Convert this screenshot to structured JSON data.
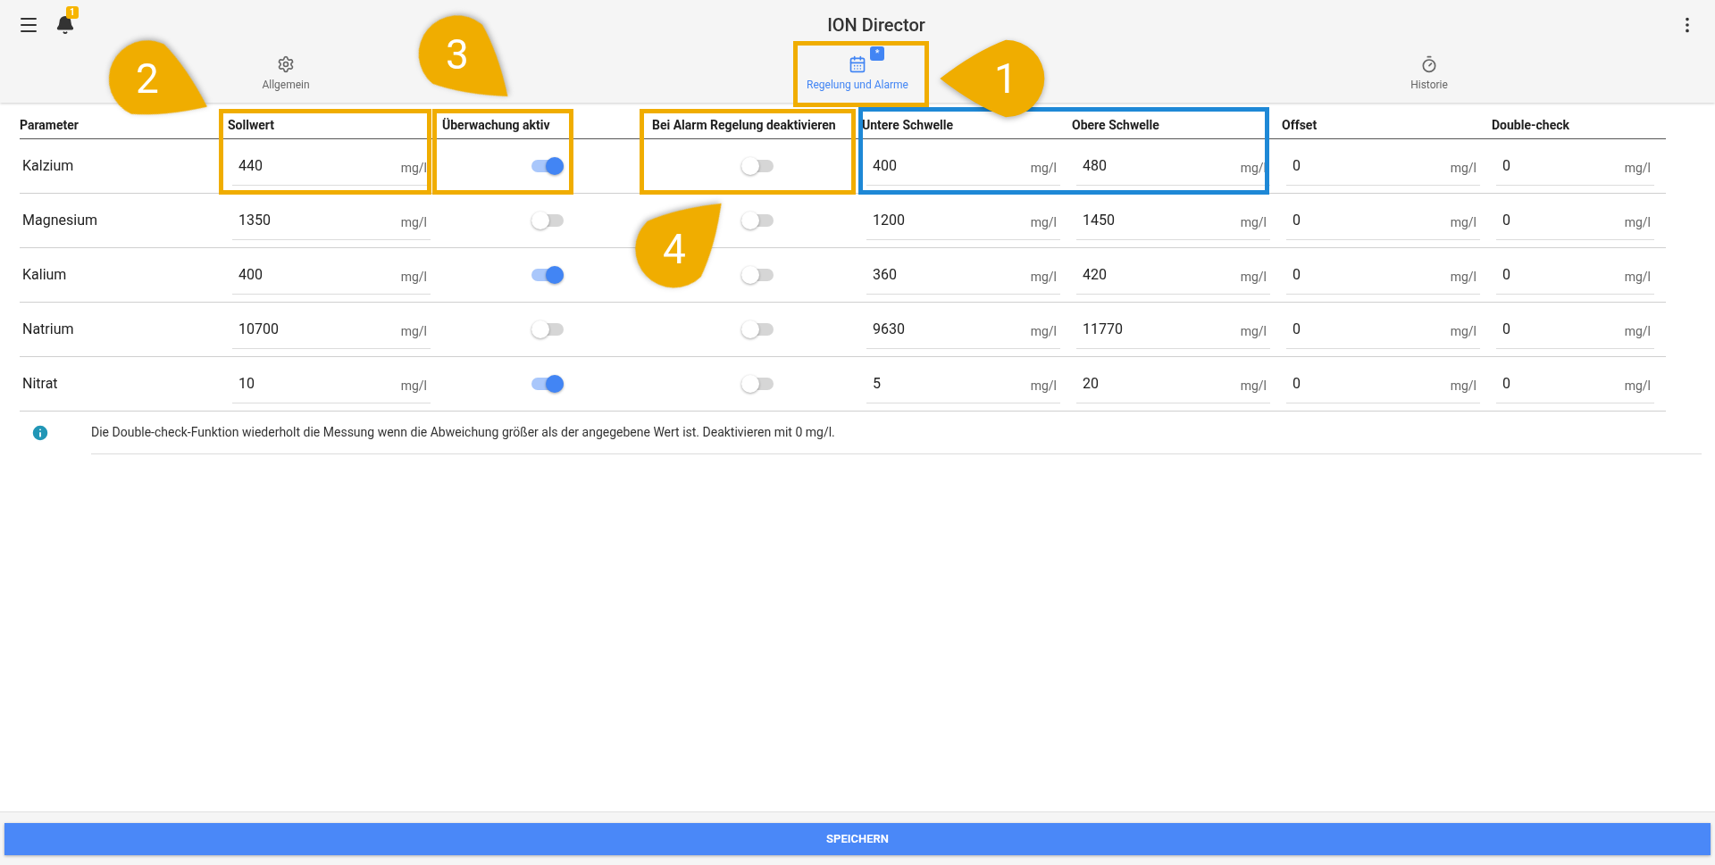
{
  "app_bar": {
    "title": "ION Director",
    "notification_count": "1"
  },
  "tabs": [
    {
      "label": "Allgemein",
      "selected": false
    },
    {
      "label": "Regelung und Alarme",
      "selected": true,
      "badge": "*"
    },
    {
      "label": "Historie",
      "selected": false
    }
  ],
  "table": {
    "columns": [
      "Parameter",
      "Sollwert",
      "Überwachung aktiv",
      "Bei Alarm Regelung deaktivieren",
      "Untere Schwelle",
      "Obere Schwelle",
      "Offset",
      "Double-check"
    ],
    "rows": [
      {
        "cells": [
          {
            "kind": "text",
            "value": "Kalzium"
          },
          {
            "kind": "input",
            "value": "440",
            "unit": "mg/l"
          },
          {
            "kind": "toggle",
            "on": true
          },
          {
            "kind": "toggle",
            "on": false
          },
          {
            "kind": "input",
            "value": "400",
            "unit": "mg/l"
          },
          {
            "kind": "input",
            "value": "480",
            "unit": "mg/l"
          },
          {
            "kind": "input",
            "value": "0",
            "unit": "mg/l"
          },
          {
            "kind": "input",
            "value": "0",
            "unit": "mg/l"
          }
        ]
      },
      {
        "cells": [
          {
            "kind": "text",
            "value": "Magnesium"
          },
          {
            "kind": "input",
            "value": "1350",
            "unit": "mg/l"
          },
          {
            "kind": "toggle",
            "on": false
          },
          {
            "kind": "toggle",
            "on": false
          },
          {
            "kind": "input",
            "value": "1200",
            "unit": "mg/l"
          },
          {
            "kind": "input",
            "value": "1450",
            "unit": "mg/l"
          },
          {
            "kind": "input",
            "value": "0",
            "unit": "mg/l"
          },
          {
            "kind": "input",
            "value": "0",
            "unit": "mg/l"
          }
        ]
      },
      {
        "cells": [
          {
            "kind": "text",
            "value": "Kalium"
          },
          {
            "kind": "input",
            "value": "400",
            "unit": "mg/l"
          },
          {
            "kind": "toggle",
            "on": true
          },
          {
            "kind": "toggle",
            "on": false
          },
          {
            "kind": "input",
            "value": "360",
            "unit": "mg/l"
          },
          {
            "kind": "input",
            "value": "420",
            "unit": "mg/l"
          },
          {
            "kind": "input",
            "value": "0",
            "unit": "mg/l"
          },
          {
            "kind": "input",
            "value": "0",
            "unit": "mg/l"
          }
        ]
      },
      {
        "cells": [
          {
            "kind": "text",
            "value": "Natrium"
          },
          {
            "kind": "input",
            "value": "10700",
            "unit": "mg/l"
          },
          {
            "kind": "toggle",
            "on": false
          },
          {
            "kind": "toggle",
            "on": false
          },
          {
            "kind": "input",
            "value": "9630",
            "unit": "mg/l"
          },
          {
            "kind": "input",
            "value": "11770",
            "unit": "mg/l"
          },
          {
            "kind": "input",
            "value": "0",
            "unit": "mg/l"
          },
          {
            "kind": "input",
            "value": "0",
            "unit": "mg/l"
          }
        ]
      },
      {
        "cells": [
          {
            "kind": "text",
            "value": "Nitrat"
          },
          {
            "kind": "input",
            "value": "10",
            "unit": "mg/l"
          },
          {
            "kind": "toggle",
            "on": true
          },
          {
            "kind": "toggle",
            "on": false
          },
          {
            "kind": "input",
            "value": "5",
            "unit": "mg/l"
          },
          {
            "kind": "input",
            "value": "20",
            "unit": "mg/l"
          },
          {
            "kind": "input",
            "value": "0",
            "unit": "mg/l"
          },
          {
            "kind": "input",
            "value": "0",
            "unit": "mg/l"
          }
        ]
      }
    ]
  },
  "info_note": "Die Double-check-Funktion wiederholt die Messung wenn die Abweichung größer als der angegebene Wert ist. Deaktivieren mit 0 mg/l.",
  "save_button": "SPEICHERN",
  "annotations": {
    "boxes": [
      {
        "color": "#f0ad00"
      },
      {
        "color": "#f0ad00"
      },
      {
        "color": "#f0ad00"
      },
      {
        "color": "#f0ad00"
      },
      {
        "color": "#1e88d6"
      }
    ],
    "callouts": [
      {
        "number": "1"
      },
      {
        "number": "2"
      },
      {
        "number": "3"
      },
      {
        "number": "4"
      }
    ]
  }
}
